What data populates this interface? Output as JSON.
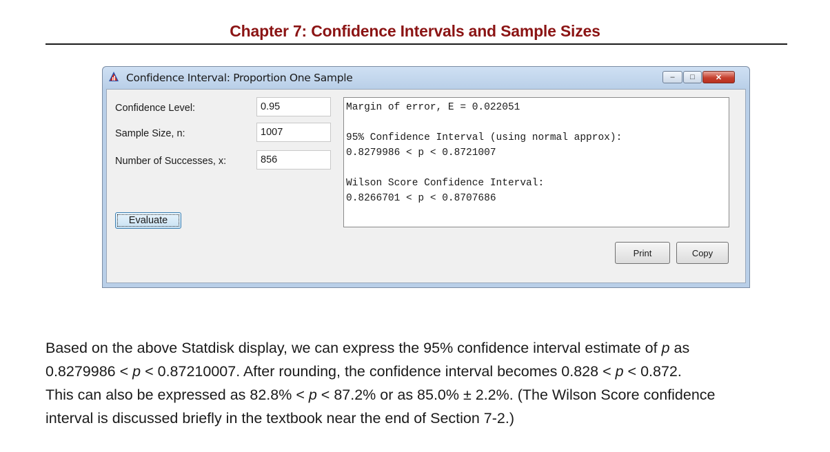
{
  "chapter_title": "Chapter 7: Confidence Intervals and Sample Sizes",
  "window": {
    "title": "Confidence Interval: Proportion One Sample",
    "controls": {
      "minimize": "–",
      "maximize": "□",
      "close": "✕"
    }
  },
  "form": {
    "confidence_level": {
      "label": "Confidence Level:",
      "value": "0.95"
    },
    "sample_size": {
      "label": "Sample Size, n:",
      "value": "1007"
    },
    "successes": {
      "label": "Number of Successes, x:",
      "value": "856"
    }
  },
  "output": {
    "line1": "Margin of error, E = 0.022051",
    "line2": "95% Confidence Interval (using normal approx):",
    "line3": "0.8279986 < p < 0.8721007",
    "line4": "Wilson Score Confidence Interval:",
    "line5": "0.8266701 < p < 0.8707686"
  },
  "buttons": {
    "evaluate": "Evaluate",
    "print": "Print",
    "copy": "Copy"
  },
  "paragraph": {
    "l1a": "Based on the above Statdisk display, we can express the 95% confidence interval estimate of ",
    "p": "p",
    "l1b": " as",
    "l2a": "0.8279986 < ",
    "l2b": " < 0.87210007. After rounding, the confidence interval becomes 0.828 < ",
    "l2c": " < 0.872.",
    "l3a": "This can also be expressed as 82.8% < ",
    "l3b": " < 87.2% or as 85.0% ± 2.2%.  (The Wilson Score confidence",
    "l4": "interval is discussed briefly in the textbook near the end of Section 7-2.)"
  }
}
